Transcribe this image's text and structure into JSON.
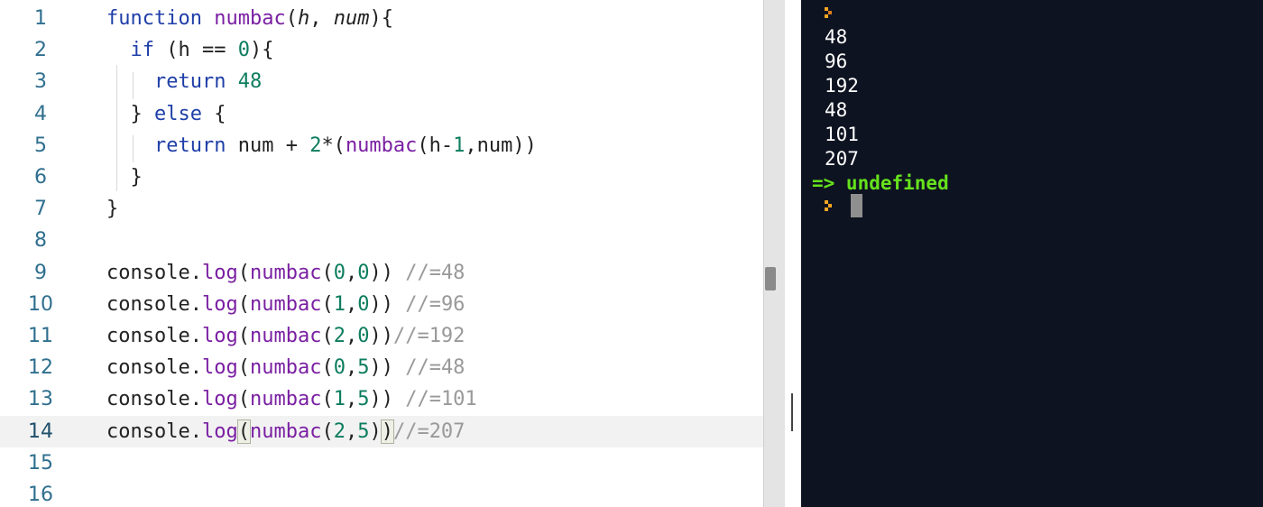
{
  "editor": {
    "lines": [
      {
        "n": "1",
        "tokens": [
          {
            "t": "function",
            "c": "k"
          },
          {
            "t": " "
          },
          {
            "t": "numbac",
            "c": "fn"
          },
          {
            "t": "("
          },
          {
            "t": "h",
            "c": "param"
          },
          {
            "t": ", "
          },
          {
            "t": "num",
            "c": "param"
          },
          {
            "t": "){"
          }
        ]
      },
      {
        "n": "2",
        "tokens": [
          {
            "t": "  "
          },
          {
            "t": "if",
            "c": "k"
          },
          {
            "t": " (h == "
          },
          {
            "t": "0",
            "c": "num"
          },
          {
            "t": "){"
          }
        ]
      },
      {
        "n": "3",
        "tokens": [
          {
            "t": "    "
          },
          {
            "t": "return",
            "c": "k"
          },
          {
            "t": " "
          },
          {
            "t": "48",
            "c": "num"
          }
        ]
      },
      {
        "n": "4",
        "tokens": [
          {
            "t": "  } "
          },
          {
            "t": "else",
            "c": "k"
          },
          {
            "t": " {"
          }
        ]
      },
      {
        "n": "5",
        "tokens": [
          {
            "t": "    "
          },
          {
            "t": "return",
            "c": "k"
          },
          {
            "t": " num + "
          },
          {
            "t": "2",
            "c": "num"
          },
          {
            "t": "*("
          },
          {
            "t": "numbac",
            "c": "fn"
          },
          {
            "t": "(h-"
          },
          {
            "t": "1",
            "c": "num"
          },
          {
            "t": ",num))"
          }
        ]
      },
      {
        "n": "6",
        "tokens": [
          {
            "t": "  }"
          }
        ]
      },
      {
        "n": "7",
        "tokens": [
          {
            "t": "}"
          }
        ]
      },
      {
        "n": "8",
        "tokens": []
      },
      {
        "n": "9",
        "tokens": [
          {
            "t": "console."
          },
          {
            "t": "log",
            "c": "fn"
          },
          {
            "t": "("
          },
          {
            "t": "numbac",
            "c": "fn"
          },
          {
            "t": "("
          },
          {
            "t": "0",
            "c": "num"
          },
          {
            "t": ","
          },
          {
            "t": "0",
            "c": "num"
          },
          {
            "t": ")) "
          },
          {
            "t": "//=48",
            "c": "cmt"
          }
        ]
      },
      {
        "n": "10",
        "tokens": [
          {
            "t": "console."
          },
          {
            "t": "log",
            "c": "fn"
          },
          {
            "t": "("
          },
          {
            "t": "numbac",
            "c": "fn"
          },
          {
            "t": "("
          },
          {
            "t": "1",
            "c": "num"
          },
          {
            "t": ","
          },
          {
            "t": "0",
            "c": "num"
          },
          {
            "t": ")) "
          },
          {
            "t": "//=96",
            "c": "cmt"
          }
        ]
      },
      {
        "n": "11",
        "tokens": [
          {
            "t": "console."
          },
          {
            "t": "log",
            "c": "fn"
          },
          {
            "t": "("
          },
          {
            "t": "numbac",
            "c": "fn"
          },
          {
            "t": "("
          },
          {
            "t": "2",
            "c": "num"
          },
          {
            "t": ","
          },
          {
            "t": "0",
            "c": "num"
          },
          {
            "t": "))"
          },
          {
            "t": "//=192",
            "c": "cmt"
          }
        ]
      },
      {
        "n": "12",
        "tokens": [
          {
            "t": "console."
          },
          {
            "t": "log",
            "c": "fn"
          },
          {
            "t": "("
          },
          {
            "t": "numbac",
            "c": "fn"
          },
          {
            "t": "("
          },
          {
            "t": "0",
            "c": "num"
          },
          {
            "t": ","
          },
          {
            "t": "5",
            "c": "num"
          },
          {
            "t": ")) "
          },
          {
            "t": "//=48",
            "c": "cmt"
          }
        ]
      },
      {
        "n": "13",
        "tokens": [
          {
            "t": "console."
          },
          {
            "t": "log",
            "c": "fn"
          },
          {
            "t": "("
          },
          {
            "t": "numbac",
            "c": "fn"
          },
          {
            "t": "("
          },
          {
            "t": "1",
            "c": "num"
          },
          {
            "t": ","
          },
          {
            "t": "5",
            "c": "num"
          },
          {
            "t": ")) "
          },
          {
            "t": "//=101",
            "c": "cmt"
          }
        ]
      },
      {
        "n": "14",
        "active": true,
        "tokens": [
          {
            "t": "console."
          },
          {
            "t": "log",
            "c": "fn"
          },
          {
            "t": "(",
            "c": "br"
          },
          {
            "t": "numbac",
            "c": "fn"
          },
          {
            "t": "("
          },
          {
            "t": "2",
            "c": "num"
          },
          {
            "t": ","
          },
          {
            "t": "5",
            "c": "num"
          },
          {
            "t": ")"
          },
          {
            "t": ")",
            "c": "br"
          },
          {
            "t": "//=207",
            "c": "cmt"
          }
        ]
      },
      {
        "n": "15",
        "tokens": []
      },
      {
        "n": "16",
        "tokens": []
      }
    ]
  },
  "console": {
    "outputs": [
      "48",
      "96",
      "192",
      "48",
      "101",
      "207"
    ],
    "result_text": "=> undefined"
  },
  "colors": {
    "editor_bg": "#ffffff",
    "console_bg": "#0e1321",
    "keyword": "#1f3fa8",
    "function": "#7a1fa2",
    "number": "#0c7d5e",
    "comment": "#999999",
    "result": "#66e21c",
    "prompt": "#f5a623"
  },
  "icons": {
    "prompt": "chevron-prompt-icon"
  }
}
